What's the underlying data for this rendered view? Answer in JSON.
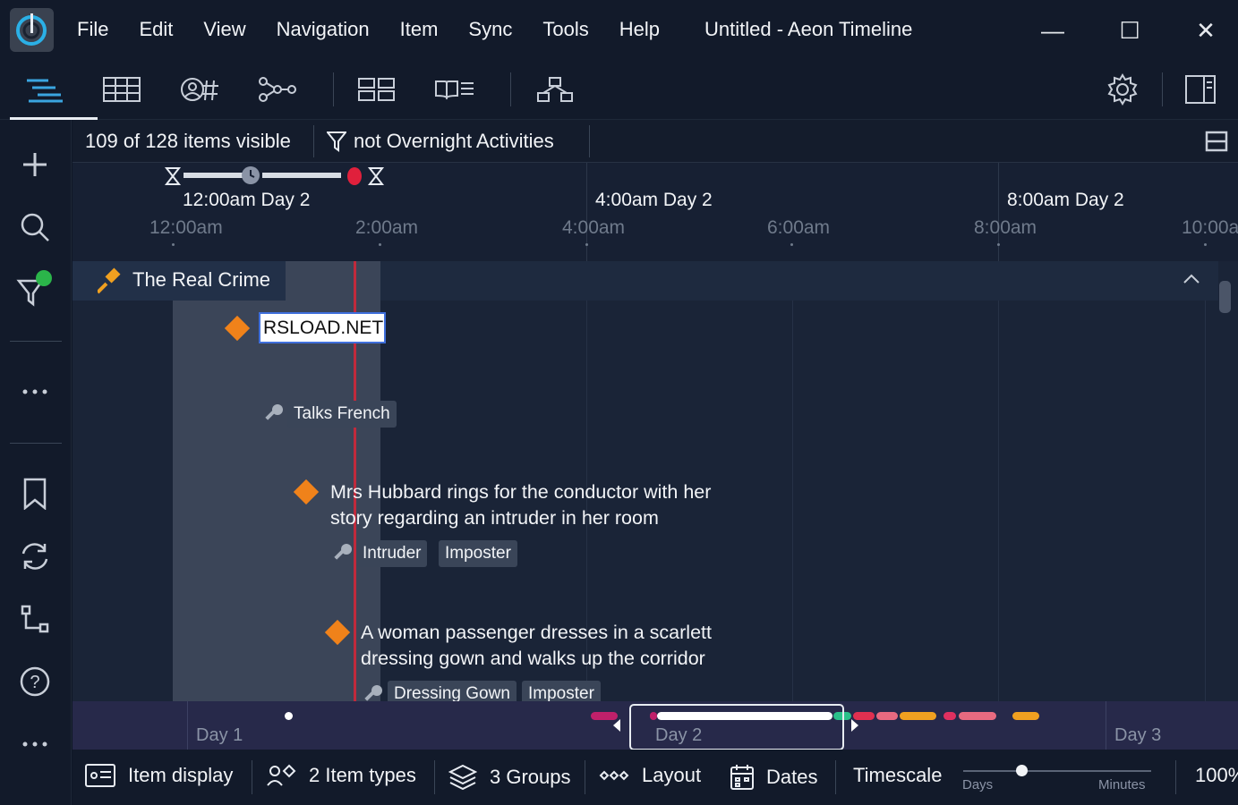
{
  "window": {
    "title": "Untitled - Aeon Timeline",
    "menu": [
      "File",
      "Edit",
      "View",
      "Navigation",
      "Item",
      "Sync",
      "Tools",
      "Help"
    ],
    "controls": {
      "minimize": "—",
      "maximize": "☐",
      "close": "✕"
    }
  },
  "filter": {
    "count_text": "109 of 128 items visible",
    "filter_text": "not Overnight Activities"
  },
  "ruler": {
    "major": [
      "12:00am Day 2",
      "4:00am Day 2",
      "8:00am Day 2"
    ],
    "minor": [
      "12:00am",
      "2:00am",
      "4:00am",
      "6:00am",
      "8:00am",
      "10:00a"
    ]
  },
  "arc": {
    "name": "The Real Crime"
  },
  "events": [
    {
      "title": "RSLOAD.NET",
      "tags": [],
      "selected": true
    },
    {
      "title": "",
      "tags": [
        "Talks French"
      ]
    },
    {
      "title_line1": "Mrs Hubbard rings for the conductor with her",
      "title_line2": "story regarding an intruder in her room",
      "tags": [
        "Intruder",
        "Imposter"
      ]
    },
    {
      "title_line1": "A woman passenger dresses in a scarlett",
      "title_line2": "dressing gown and walks up the corridor",
      "tags": [
        "Dressing Gown",
        "Imposter"
      ]
    }
  ],
  "overview": {
    "days": [
      "Day 1",
      "Day 2",
      "Day 3"
    ]
  },
  "statusbar": {
    "item_display": "Item display",
    "item_types": "2 Item types",
    "groups": "3 Groups",
    "layout": "Layout",
    "dates": "Dates",
    "timescale": "Timescale",
    "scale_min_label": "Days",
    "scale_max_label": "Minutes",
    "zoom": "100%"
  },
  "colors": {
    "accent": "#f0821a",
    "now_line": "#c02a3c",
    "filter_badge": "#2bb54a"
  }
}
